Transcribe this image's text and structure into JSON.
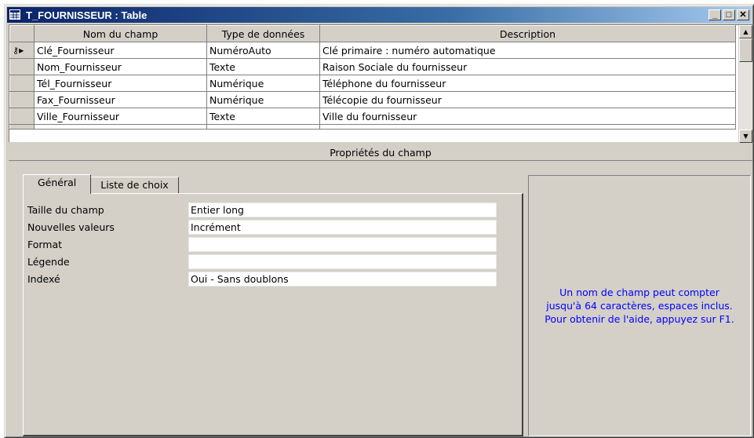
{
  "window": {
    "title": "T_FOURNISSEUR : Table",
    "minimize": "_",
    "maximize": "□",
    "close": "✕"
  },
  "grid": {
    "headers": [
      "Nom du champ",
      "Type de données",
      "Description"
    ],
    "rows": [
      {
        "name": "Clé_Fournisseur",
        "type": "NuméroAuto",
        "description": "Clé primaire : numéro automatique"
      },
      {
        "name": "Nom_Fournisseur",
        "type": "Texte",
        "description": "Raison Sociale du fournisseur"
      },
      {
        "name": "Tél_Fournisseur",
        "type": "Numérique",
        "description": "Téléphone du fournisseur"
      },
      {
        "name": "Fax_Fournisseur",
        "type": "Numérique",
        "description": "Télécopie du fournisseur"
      },
      {
        "name": "Ville_Fournisseur",
        "type": "Texte",
        "description": "Ville du fournisseur"
      }
    ]
  },
  "properties": {
    "header": "Propriétés du champ",
    "tabs": [
      "Général",
      "Liste de choix"
    ],
    "fields": [
      {
        "label": "Taille du champ",
        "value": "Entier long"
      },
      {
        "label": "Nouvelles valeurs",
        "value": "Incrément"
      },
      {
        "label": "Format",
        "value": ""
      },
      {
        "label": "Légende",
        "value": ""
      },
      {
        "label": "Indexé",
        "value": "Oui - Sans doublons"
      }
    ]
  },
  "help": {
    "text": "Un nom de champ peut compter jusqu'à 64 caractères, espaces inclus. Pour obtenir de l'aide, appuyez sur F1."
  },
  "colors": {
    "titlebar": "#0a246a",
    "help_text": "#0000ff",
    "face": "#d4d0c8"
  }
}
